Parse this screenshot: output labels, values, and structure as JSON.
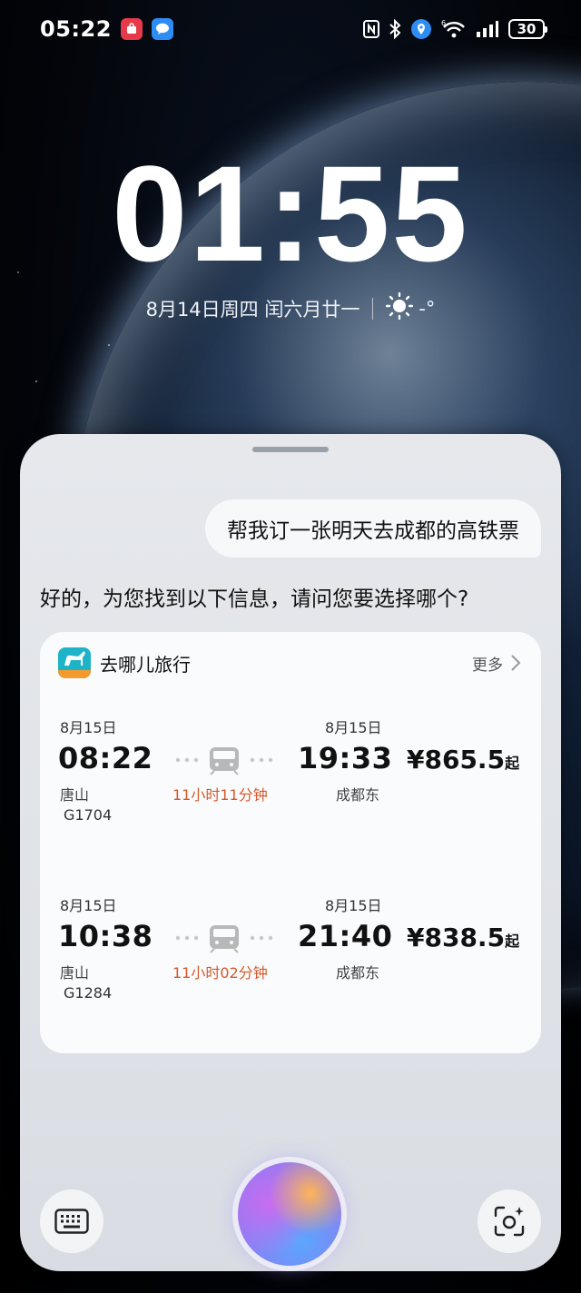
{
  "status_bar": {
    "time": "05:22",
    "battery": "30",
    "apps": [
      {
        "name": "app-gallery-icon",
        "color": "#e6394a"
      },
      {
        "name": "message-icon",
        "color": "#2e8cf5"
      }
    ],
    "icons": [
      "nfc-icon",
      "bluetooth-icon",
      "location-icon",
      "wifi-6-icon",
      "signal-icon",
      "battery-icon"
    ]
  },
  "lock_screen": {
    "clock": "01:55",
    "date": "8月14日周四 闰六月廿一",
    "weather_temp": "-°",
    "weather_icon": "sun-icon"
  },
  "assistant": {
    "user_message": "帮我订一张明天去成都的高铁票",
    "reply": "好的，为您找到以下信息，请问您要选择哪个?",
    "card": {
      "app_name": "去哪儿旅行",
      "app_color": "#1fb3c8",
      "more_label": "更多",
      "trips": [
        {
          "depart_date": "8月15日",
          "depart_time": "08:22",
          "depart_station": "唐山",
          "train_no": "G1704",
          "duration": "11小时11分钟",
          "arrive_date": "8月15日",
          "arrive_time": "19:33",
          "arrive_station": "成都东",
          "price": "¥865.5",
          "price_suffix": "起"
        },
        {
          "depart_date": "8月15日",
          "depart_time": "10:38",
          "depart_station": "唐山",
          "train_no": "G1284",
          "duration": "11小时02分钟",
          "arrive_date": "8月15日",
          "arrive_time": "21:40",
          "arrive_station": "成都东",
          "price": "¥838.5",
          "price_suffix": "起"
        }
      ]
    },
    "controls": {
      "keyboard_icon": "keyboard-icon",
      "scan_icon": "scan-icon",
      "orb": "voice-orb"
    },
    "accent_duration_color": "#d35a2b"
  }
}
